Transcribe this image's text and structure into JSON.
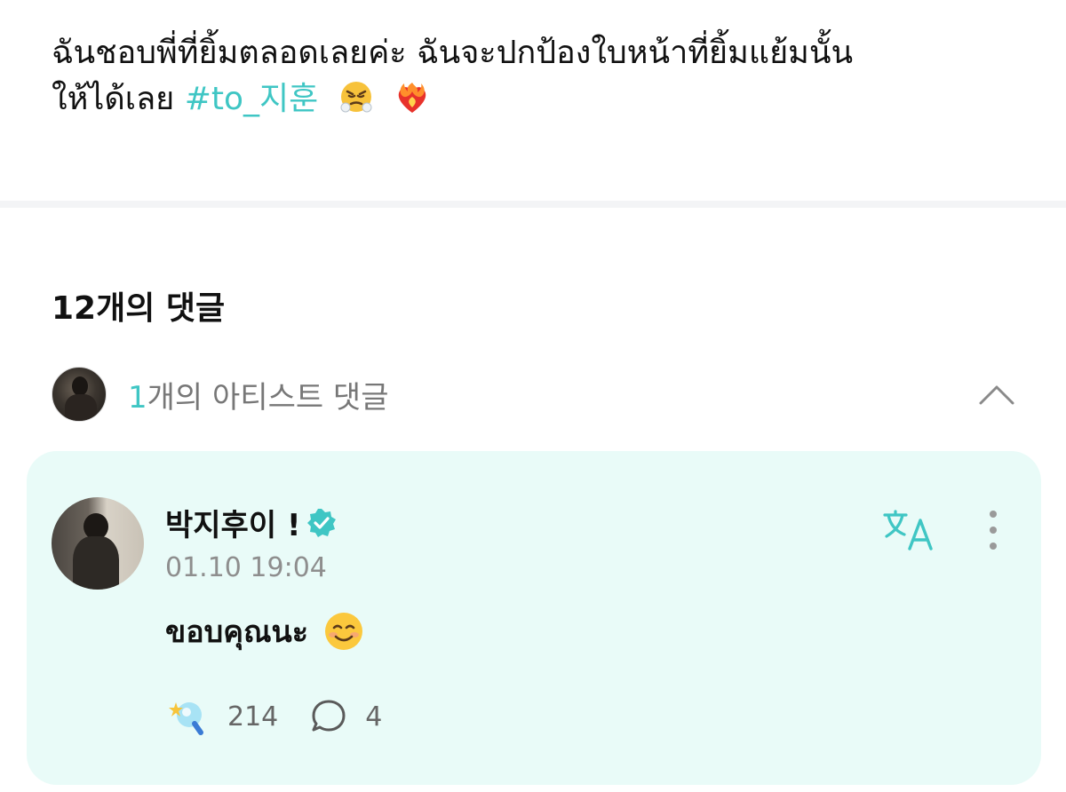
{
  "post": {
    "text_line1": "ฉันชอบพี่ที่ยิ้มตลอดเลยค่ะ ฉันจะปกป้องใบหน้าที่ยิ้มแย้มนั้น",
    "text_line2": "ให้ได้เลย",
    "hashtag": "#to_지훈",
    "emojis": [
      "steam-from-nose-emoji",
      "heart-on-fire-emoji"
    ]
  },
  "comments": {
    "header": "12개의 댓글",
    "artist_summary": {
      "count": "1",
      "label": "개의 아티스트 댓글"
    }
  },
  "artist_comment": {
    "author": "박지후이 !",
    "timestamp": "01.10 19:04",
    "text": "ขอบคุณนะ",
    "like_count": "214",
    "reply_count": "4"
  },
  "colors": {
    "accent": "#3fc6c4",
    "card_background": "#e9fbf8",
    "muted_text": "#8e8e8e"
  },
  "icons": [
    "chevron-up-icon",
    "verified-badge-icon",
    "translate-icon",
    "more-vertical-icon",
    "like-icon",
    "reply-bubble-icon"
  ]
}
